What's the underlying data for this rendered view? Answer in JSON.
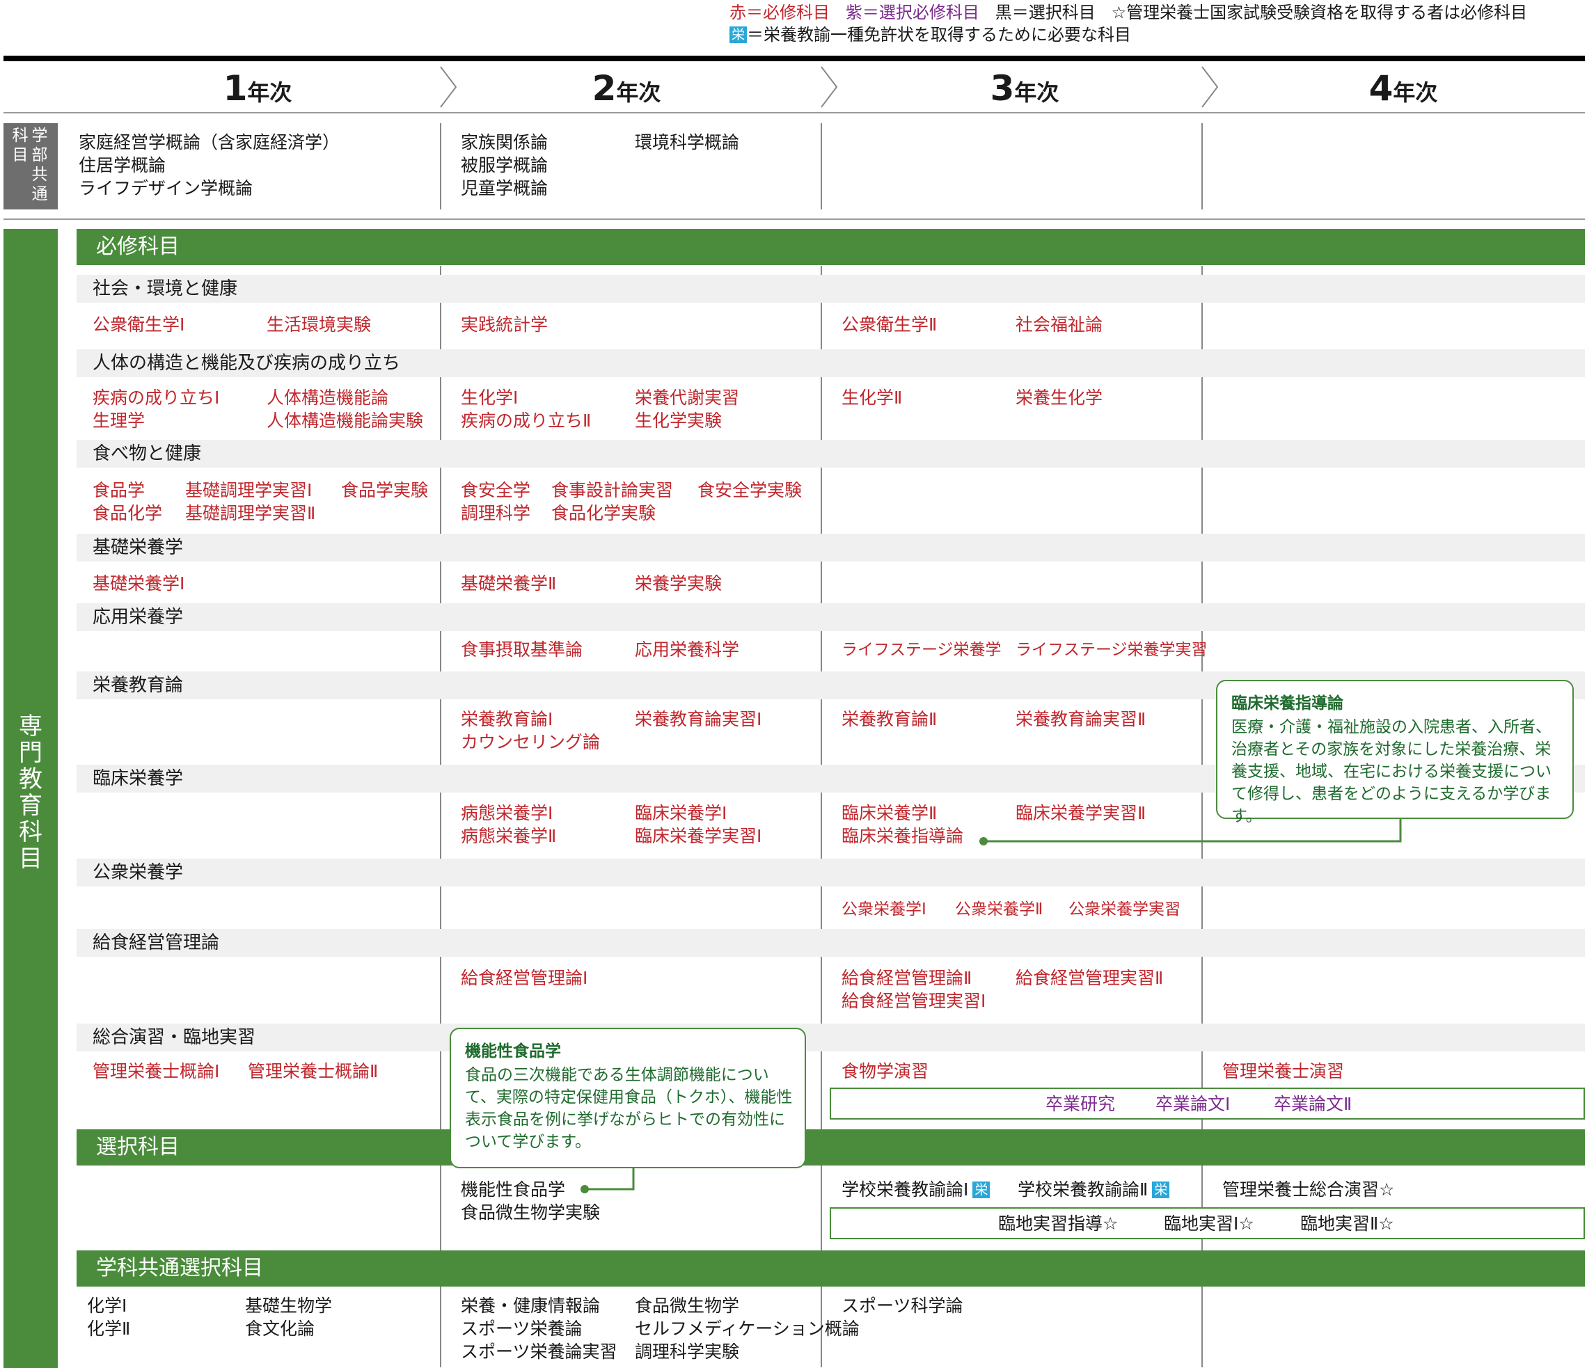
{
  "legend": {
    "red": "赤＝必修科目",
    "purple": "紫＝選択必修科目",
    "black": "黒＝選択科目",
    "star_note": "☆管理栄養士国家試験受験資格を取得する者は必修科目",
    "badge": "栄",
    "badge_note": "＝栄養教諭一種免許状を取得するために必要な科目"
  },
  "years": [
    {
      "num": "1",
      "label": "年次"
    },
    {
      "num": "2",
      "label": "年次"
    },
    {
      "num": "3",
      "label": "年次"
    },
    {
      "num": "4",
      "label": "年次"
    }
  ],
  "common": {
    "side_label": "科学部共通",
    "y1": [
      "家庭経営学概論（含家庭経済学）",
      "住居学概論",
      "ライフデザイン学概論"
    ],
    "y2a": [
      "家族関係論",
      "被服学概論",
      "児童学概論"
    ],
    "y2b": [
      "環境科学概論"
    ]
  },
  "specialty_label": "専門教育科目",
  "required_label": "必修科目",
  "categories": [
    "社会・環境と健康",
    "人体の構造と機能及び疾病の成り立ち",
    "食べ物と健康",
    "基礎栄養学",
    "応用栄養学",
    "栄養教育論",
    "臨床栄養学",
    "公衆栄養学",
    "給食経営管理論",
    "総合演習・臨地実習"
  ],
  "subjects": {
    "c0": [
      "公衆衛生学Ⅰ",
      "生活環境実験",
      "実践統計学",
      "公衆衛生学Ⅱ",
      "社会福祉論"
    ],
    "c1": [
      "疾病の成り立ちⅠ",
      "生理学",
      "人体構造機能論",
      "人体構造機能論実験",
      "生化学Ⅰ",
      "疾病の成り立ちⅡ",
      "栄養代謝実習",
      "生化学実験",
      "生化学Ⅱ",
      "栄養生化学"
    ],
    "c2": [
      "食品学",
      "食品化学",
      "基礎調理学実習Ⅰ",
      "基礎調理学実習Ⅱ",
      "食品学実験",
      "食安全学",
      "調理科学",
      "食事設計論実習",
      "食品化学実験",
      "食安全学実験"
    ],
    "c3": [
      "基礎栄養学Ⅰ",
      "基礎栄養学Ⅱ",
      "栄養学実験"
    ],
    "c4": [
      "食事摂取基準論",
      "応用栄養科学",
      "ライフステージ栄養学",
      "ライフステージ栄養学実習"
    ],
    "c5": [
      "栄養教育論Ⅰ",
      "カウンセリング論",
      "栄養教育論実習Ⅰ",
      "栄養教育論Ⅱ",
      "栄養教育論実習Ⅱ"
    ],
    "c6": [
      "病態栄養学Ⅰ",
      "病態栄養学Ⅱ",
      "臨床栄養学Ⅰ",
      "臨床栄養学実習Ⅰ",
      "臨床栄養学Ⅱ",
      "臨床栄養指導論",
      "臨床栄養学実習Ⅱ"
    ],
    "c7": [
      "公衆栄養学Ⅰ",
      "公衆栄養学Ⅱ",
      "公衆栄養学実習"
    ],
    "c8": [
      "給食経営管理論Ⅰ",
      "給食経営管理論Ⅱ",
      "給食経営管理実習Ⅰ",
      "給食経営管理実習Ⅱ"
    ],
    "c9": [
      "管理栄養士概論Ⅰ",
      "管理栄養士概論Ⅱ",
      "食物学演習",
      "管理栄養士演習"
    ],
    "thesis": [
      "卒業研究",
      "卒業論文Ⅰ",
      "卒業論文Ⅱ"
    ]
  },
  "elective_label": "選択科目",
  "elective": {
    "y2": [
      "機能性食品学",
      "食品微生物学実験"
    ],
    "y3a": "学校栄養教諭論Ⅰ",
    "y3b": "学校栄養教諭論Ⅱ",
    "y4": "管理栄養士総合演習☆",
    "practicum": [
      "臨地実習指導☆",
      "臨地実習Ⅰ☆",
      "臨地実習Ⅱ☆"
    ]
  },
  "dept_label": "学科共通選択科目",
  "dept": {
    "y1a": [
      "化学Ⅰ",
      "化学Ⅱ"
    ],
    "y1b": [
      "基礎生物学",
      "食文化論"
    ],
    "y2a": [
      "栄養・健康情報論",
      "スポーツ栄養論",
      "スポーツ栄養論実習"
    ],
    "y2b": [
      "食品微生物学",
      "セルフメディケーション概論",
      "調理科学実験"
    ],
    "y3": [
      "スポーツ科学論"
    ]
  },
  "callout_clinical": {
    "title": "臨床栄養指導論",
    "body": "医療・介護・福祉施設の入院患者、入所者、治療者とその家族を対象にした栄養治療、栄養支援、地域、在宅における栄養支援について修得し、患者をどのように支えるか学びます。"
  },
  "callout_functional": {
    "title": "機能性食品学",
    "body": "食品の三次機能である生体調節機能について、実際の特定保健用食品（トクホ）、機能性表示食品を例に挙げながらヒトでの有効性について学びます。"
  },
  "colors": {
    "green": "#4a8c3c",
    "red": "#c0272d",
    "purple": "#7b2a8e",
    "cyan": "#2aa7d9"
  }
}
